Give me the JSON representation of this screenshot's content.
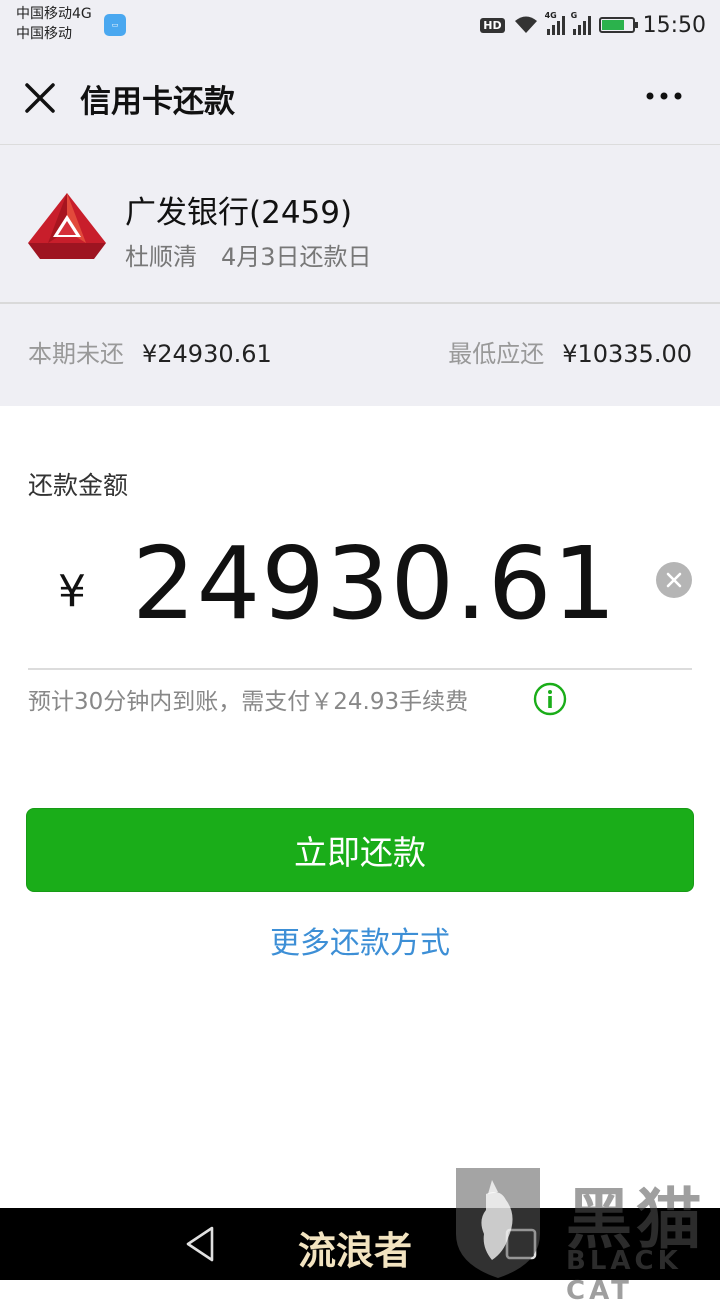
{
  "status_bar": {
    "carrier_1": "中国移动4G",
    "carrier_2": "中国移动",
    "hd": "HD",
    "signal_1": "4G",
    "signal_2": "G",
    "battery_level": 0.7,
    "time": "15:50"
  },
  "nav": {
    "title": "信用卡还款",
    "close_icon": "close-icon",
    "more_icon": "more-horizontal-icon"
  },
  "card": {
    "bank_name": "广发银行(2459)",
    "holder": "杜顺清",
    "due_date": "4月3日还款日",
    "logo_colors": [
      "#c81e2b",
      "#e04a3a",
      "#8b0f1a"
    ]
  },
  "summary": {
    "unpaid_label": "本期未还",
    "unpaid_amount": "¥24930.61",
    "min_label": "最低应还",
    "min_amount": "¥10335.00"
  },
  "payment": {
    "label": "还款金额",
    "currency": "¥",
    "amount": "24930.61",
    "fee_note": "预计30分钟内到账，需支付￥24.93手续费",
    "pay_button": "立即还款",
    "more_methods": "更多还款方式"
  },
  "colors": {
    "accent_green": "#1aad19",
    "link_blue": "#3d8fd6",
    "info_green": "#1aad19"
  },
  "watermark": {
    "text": "黑猫",
    "sub": "BLACK CAT"
  },
  "bottom_nav": {
    "home_label": "流浪者"
  }
}
